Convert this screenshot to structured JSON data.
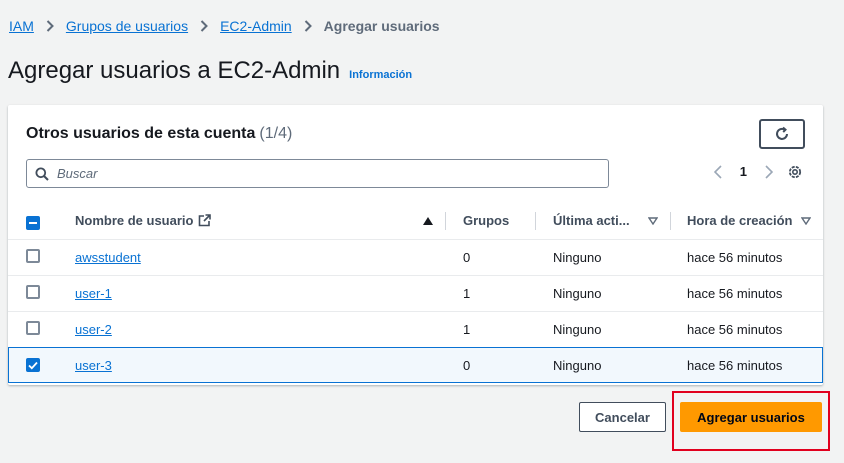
{
  "breadcrumb": {
    "items": [
      "IAM",
      "Grupos de usuarios",
      "EC2-Admin"
    ],
    "current": "Agregar usuarios"
  },
  "page": {
    "title": "Agregar usuarios a EC2-Admin",
    "info_link": "Información"
  },
  "panel": {
    "title": "Otros usuarios de esta cuenta",
    "count": "(1/4)",
    "search_placeholder": "Buscar",
    "current_page": "1"
  },
  "table": {
    "headers": {
      "name": "Nombre de usuario",
      "groups": "Grupos",
      "last_activity": "Última acti...",
      "created": "Hora de creación"
    },
    "rows": [
      {
        "name": "awsstudent",
        "groups": "0",
        "last_activity": "Ninguno",
        "created": "hace 56 minutos",
        "selected": false
      },
      {
        "name": "user-1",
        "groups": "1",
        "last_activity": "Ninguno",
        "created": "hace 56 minutos",
        "selected": false
      },
      {
        "name": "user-2",
        "groups": "1",
        "last_activity": "Ninguno",
        "created": "hace 56 minutos",
        "selected": false
      },
      {
        "name": "user-3",
        "groups": "0",
        "last_activity": "Ninguno",
        "created": "hace 56 minutos",
        "selected": true
      }
    ]
  },
  "actions": {
    "cancel": "Cancelar",
    "add": "Agregar usuarios"
  },
  "colors": {
    "link": "#0972d3",
    "primary_button": "#ff9900",
    "highlight_box": "#e1001e",
    "selected_row_bg": "#f2f8fd"
  },
  "icons": {
    "breadcrumb_separator": "chevron-right-icon",
    "refresh": "refresh-icon",
    "search": "search-icon",
    "external_link": "external-link-icon",
    "settings": "gear-icon"
  }
}
